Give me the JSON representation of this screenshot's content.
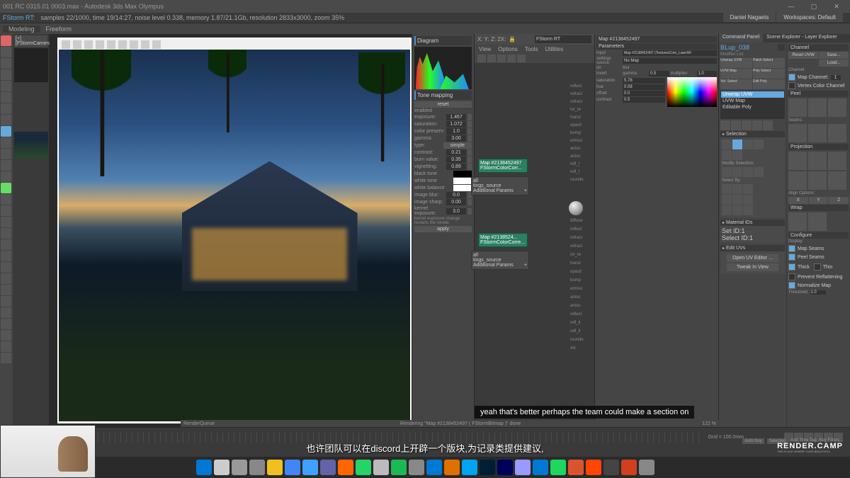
{
  "window": {
    "title": "001 RC 0315.01 0003.max - Autodesk 3ds Max Olympus",
    "user_tab": "Daniel Nagaets",
    "workspace_tab": "Workspaces: Default"
  },
  "render_status": {
    "label": "FStorm RT:",
    "text": "samples 22/1000, time 19/14:27, noise level 0.338, memory 1.87/21.1Gb, resolution 2833x3000, zoom 35%"
  },
  "ribbon_tabs": [
    "Modeling",
    "Freeform"
  ],
  "scene_tab": "[+][FStormCamera",
  "slate": {
    "title": "Diagram",
    "section_tonemap": "Tone mapping",
    "btn_reset": "reset",
    "btn_simple": "simple",
    "btn_apply": "apply",
    "params": {
      "enabled": "enabled",
      "exposure": "exposure:",
      "exposure_v": "1.467",
      "saturation": "saturation:",
      "saturation_v": "1.072",
      "color_preserv": "color preserv:",
      "color_preserv_v": "1.0",
      "gamma": "gamma:",
      "gamma_v": "3.00",
      "type": "type:",
      "contrast": "contrast:",
      "contrast_v": "0.21",
      "burn": "burn value:",
      "burn_v": "0.35",
      "vignetting": "vignetting:",
      "vignetting_v": "0.89",
      "black": "black tone",
      "white": "white tone",
      "wb": "white balance",
      "imgblur": "image blur:",
      "imgblur_v": "0.0",
      "imgsharp": "image sharp:",
      "imgsharp_v": "0.00",
      "kernexp": "kernel exposure:",
      "kernexp_v": "3.0",
      "kernnote": "kernel exposure change restarts the render."
    }
  },
  "node_editor": {
    "xyz": "X: Y: Z: 2X:",
    "search": "FStorm RT",
    "menu": [
      "View",
      "Options",
      "Tools",
      "Utilities"
    ],
    "node1_title": "Map #2138452497",
    "node1_sub": "FStormColorCorr...",
    "node2_title": "Map #2138524...",
    "node2_sub": "FStormColorCorre...",
    "node_ap_label": "Additional Params",
    "node_src_label": "tings_source",
    "node_all": "all",
    "out_sockets": [
      "reflect",
      "refract",
      "refract",
      "ior_te",
      "transl",
      "opacit",
      "bump",
      "emissi",
      "aniso",
      "aniso",
      "refl_l",
      "refl_l",
      "rounde"
    ],
    "mat_sockets": [
      "diffuse",
      "reflect",
      "refract",
      "refract",
      "ior_te",
      "transl",
      "opacit",
      "bump",
      "emissi",
      "aniso",
      "aniso",
      "reflect",
      "refl_li",
      "refl_li",
      "rounde",
      "Ad"
    ]
  },
  "param_panel": {
    "title": "Map #2138452497",
    "section": "Parameters",
    "rows": {
      "input": "input",
      "input_v": "Map #2138452497 (TexturesCom_LawnWi",
      "settings": "settings source",
      "settings_v": "No Map",
      "on": "on",
      "blur_l": "blur",
      "invert": "invert",
      "gamma_l": "gamma",
      "gamma_v": "0.5",
      "mult_l": "multiplier",
      "mult_v": "1.0",
      "sat": "saturation",
      "sat_v": "5.78",
      "hue": "hue",
      "hue_v": "0.08",
      "off": "offset",
      "off_v": "0.0",
      "con": "contrast",
      "con_v": "0.5"
    }
  },
  "cmd_panel": {
    "tabs": [
      "Command Panel",
      "Scene Explorer - Layer Explorer"
    ],
    "obj_name": "BLup_038",
    "channel_title": "Channel",
    "modlist_l": "Modifier List",
    "btns": [
      "Reset UVW",
      "Save...",
      "Load..."
    ],
    "mod_btns1": [
      "Unwrap UVW",
      "Patch Select"
    ],
    "mod_btns2": [
      "UVW Map",
      "Poly Select"
    ],
    "mod_btns3": [
      "Vol. Select",
      "Edit Poly"
    ],
    "channel": "Channel:",
    "mapch": "Map Channel:",
    "mapch_v": "1",
    "vcc": "Vertex Color Channel",
    "stack": [
      "Unwrap UVW",
      "UVW Map",
      "Editable Poly"
    ],
    "sec_peel": "Peel",
    "seams_l": "Seams:",
    "sec_proj": "Projection",
    "align_l": "Align Options:",
    "sec_sel": "Selection",
    "modsel_l": "Modify Selection:",
    "selby_l": "Select By:",
    "sec_wrap": "Wrap",
    "sec_conf": "Configure",
    "display_l": "Display:",
    "chk_ms": "Map Seams",
    "chk_ps": "Peel Seams",
    "chk_th": "Thick",
    "chk_tn": "Thin",
    "chk_pf": "Prevent Reflattening",
    "chk_nm": "Normalize Map",
    "thresh_l": "Threshold:",
    "thresh_v": "1.0",
    "sec_mat": "Material IDs",
    "setid_l": "Set ID:",
    "selid_l": "Select ID:",
    "sec_edit": "Edit UVs",
    "open_uv": "Open UV Editor ...",
    "tweak": "Tweak In View"
  },
  "status_bar": {
    "queue": "RenderQueue",
    "text": "Rendering \"Map #2138452497 ( FStormBitmap )\" done",
    "zoom": "122 %",
    "grid": "Grid = 100.0mm",
    "autokey": "Auto Key",
    "setkey": "Selected",
    "addtime": "Add Time Tag",
    "keyf": "Key Filters..."
  },
  "subtitles": {
    "en": "yeah that's better perhaps the team could make a section on",
    "zh": "也许团队可以在discord上开辟一个版块,为记录类提供建议,"
  },
  "logo": {
    "main": "RENDER.CAMP",
    "sub": "THE PLACE WHERE YOUR BEAUTIFUL"
  },
  "taskbar_colors": [
    "#0078d4",
    "#ccc",
    "#999",
    "#888",
    "#f0c020",
    "#4285f4",
    "#40a0ff",
    "#6264a7",
    "#ff6600",
    "#25d366",
    "#bbb",
    "#1db954",
    "#888",
    "#0078d4",
    "#e07000",
    "#00a4ef",
    "#001e36",
    "#00005b",
    "#9999ff",
    "#0078d4",
    "#1ed760",
    "#da552f",
    "#ff4500",
    "#444",
    "#d04020",
    "#888"
  ]
}
